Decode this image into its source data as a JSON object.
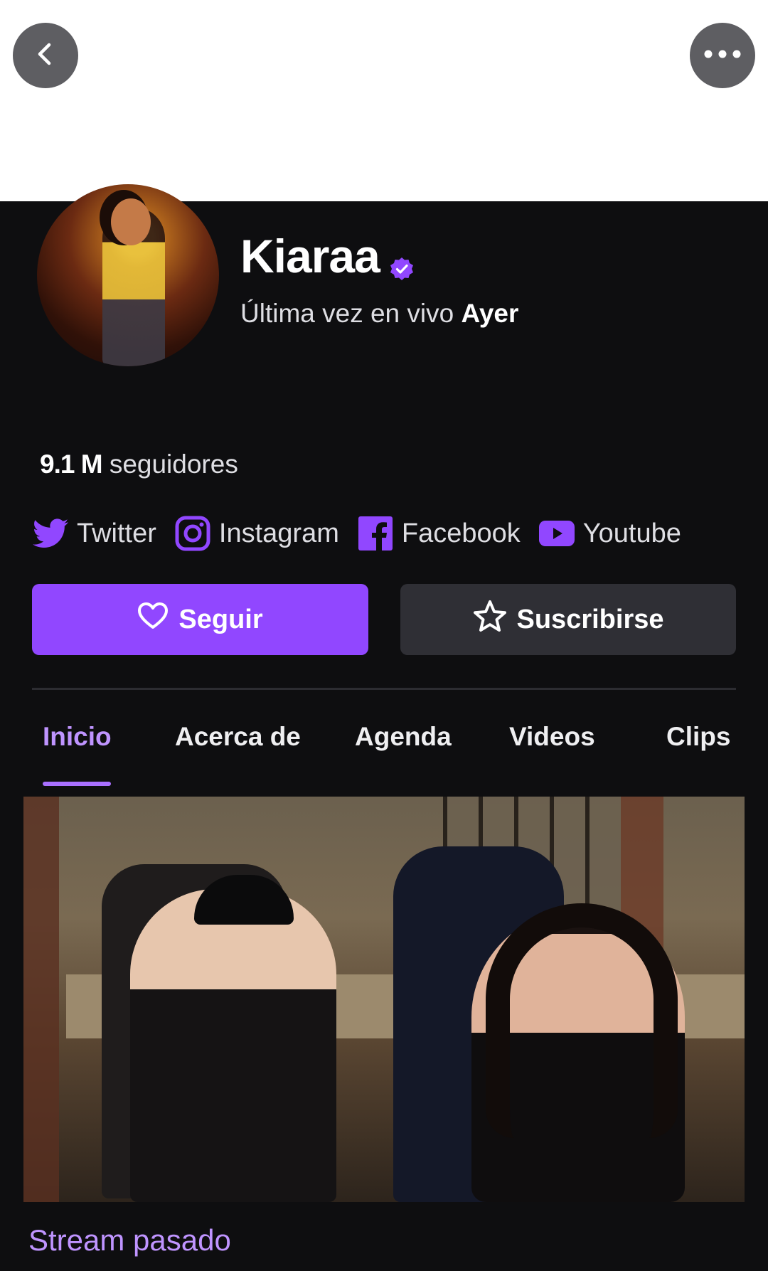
{
  "profile": {
    "name": "Kiaraa",
    "last_live_prefix": "Última vez en vivo",
    "last_live_value": "Ayer",
    "followers_count": "9.1 M",
    "followers_label": "seguidores"
  },
  "socials": [
    {
      "label": "Twitter",
      "icon": "twitter-icon"
    },
    {
      "label": "Instagram",
      "icon": "instagram-icon"
    },
    {
      "label": "Facebook",
      "icon": "facebook-icon"
    },
    {
      "label": "Youtube",
      "icon": "youtube-icon"
    }
  ],
  "actions": {
    "follow_label": "Seguir",
    "subscribe_label": "Suscribirse"
  },
  "tabs": [
    {
      "label": "Inicio",
      "active": true
    },
    {
      "label": "Acerca de",
      "active": false
    },
    {
      "label": "Agenda",
      "active": false
    },
    {
      "label": "Videos",
      "active": false
    },
    {
      "label": "Clips",
      "active": false
    }
  ],
  "content": {
    "past_stream_label": "Stream pasado"
  },
  "colors": {
    "accent": "#9147ff",
    "accent_text": "#bf94ff",
    "background": "#0e0e10",
    "secondary_button": "#2f2f35"
  }
}
